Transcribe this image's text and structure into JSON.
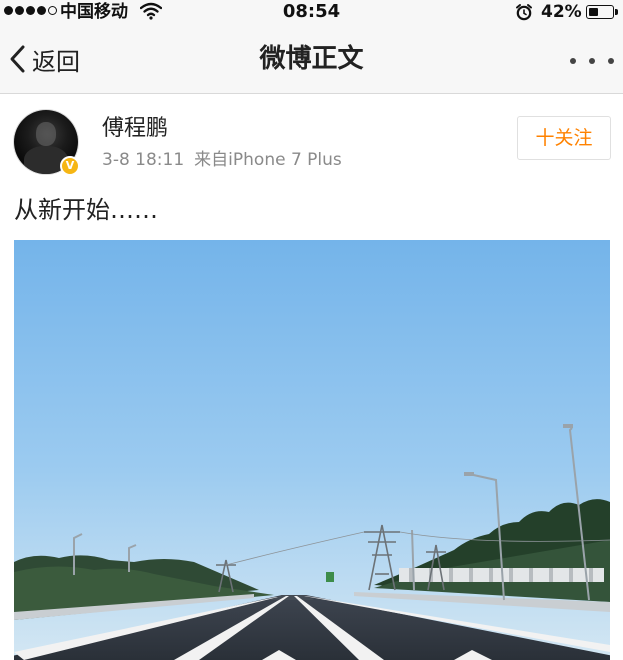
{
  "status_bar": {
    "carrier": "中国移动",
    "time": "08:54",
    "battery_text": "42%",
    "battery_level": 0.42,
    "signal_bars_filled": 4,
    "signal_bars_total": 5,
    "icons": [
      "wifi-icon",
      "alarm-icon",
      "battery-icon"
    ]
  },
  "nav": {
    "back_label": "返回",
    "title": "微博正文",
    "more_icon": "more-dots-icon"
  },
  "post": {
    "username": "傅程鹏",
    "date": "3-8 18:11",
    "source": "来自iPhone 7 Plus",
    "follow_label": "十关注",
    "text": "从新开始……",
    "verified_icon": "verified-badge-icon",
    "image_subject": "highway-road-photo"
  },
  "colors": {
    "accent": "#ff8200",
    "verified": "#f6b614",
    "bar_background": "#f7f7f7",
    "meta_text": "#8a8a8a"
  }
}
